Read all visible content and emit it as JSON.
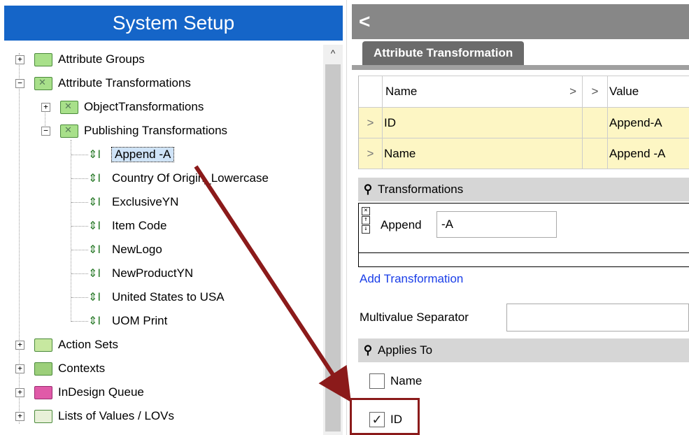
{
  "left_panel": {
    "title": "System Setup",
    "tree": [
      {
        "label": "Attribute Groups",
        "expander": "+"
      },
      {
        "label": "Attribute Transformations",
        "expander": "−"
      },
      {
        "label": "ObjectTransformations",
        "expander": "+"
      },
      {
        "label": "Publishing Transformations",
        "expander": "−"
      },
      {
        "label": "Append -A",
        "selected": true
      },
      {
        "label": "Country Of Origin_Lowercase"
      },
      {
        "label": "ExclusiveYN"
      },
      {
        "label": "Item Code"
      },
      {
        "label": "NewLogo"
      },
      {
        "label": "NewProductYN"
      },
      {
        "label": "United States to USA"
      },
      {
        "label": "UOM Print"
      },
      {
        "label": "Action Sets",
        "expander": "+"
      },
      {
        "label": "Contexts",
        "expander": "+"
      },
      {
        "label": "InDesign Queue",
        "expander": "+"
      },
      {
        "label": "Lists of Values / LOVs",
        "expander": "+"
      }
    ],
    "scroll_up_glyph": "^"
  },
  "right_panel": {
    "back_glyph": "<",
    "tab_label": "Attribute Transformation",
    "grid": {
      "col_name": "Name",
      "col_value": "Value",
      "header_arrow": ">",
      "rows": [
        {
          "name": "ID",
          "value": "Append-A"
        },
        {
          "name": "Name",
          "value": "Append -A"
        }
      ]
    },
    "transformations_section": "Transformations",
    "transformation": {
      "type": "Append",
      "value": "-A"
    },
    "add_transformation": "Add Transformation",
    "multivalue_label": "Multivalue Separator",
    "multivalue_value": "",
    "applies_to_section": "Applies To",
    "applies_to": [
      {
        "label": "Name",
        "checked": false
      },
      {
        "label": "ID",
        "checked": true
      }
    ]
  },
  "colors": {
    "header_blue": "#1565c8",
    "annotation_red": "#8b1a1a",
    "row_yellow": "#fdf6c4",
    "link_blue": "#1a3ee8"
  }
}
